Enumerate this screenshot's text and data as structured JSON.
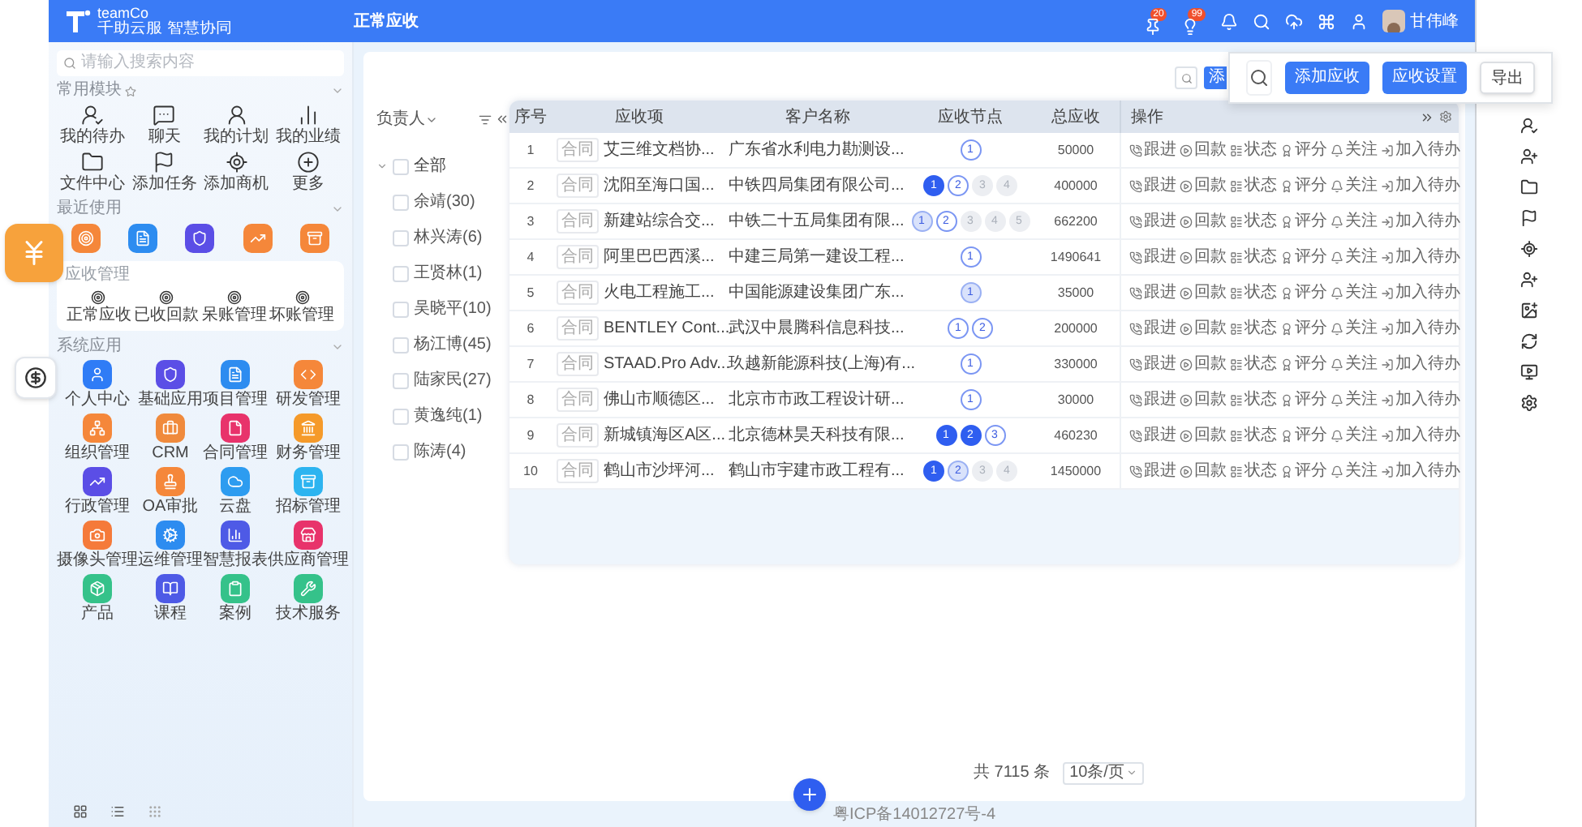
{
  "app": {
    "logo": "teamCo",
    "tagline": "千助云服 智慧协同",
    "page_title": "正常应收",
    "user": "甘伟峰",
    "badges": [
      "20",
      "99"
    ]
  },
  "sidebar": {
    "search_placeholder": "请输入搜索内容",
    "favorites": {
      "title": "常用模块",
      "items": [
        "我的待办",
        "聊天",
        "我的计划",
        "我的业绩",
        "文件中心",
        "添加任务",
        "添加商机",
        "更多"
      ]
    },
    "recent": {
      "title": "最近使用",
      "items": [
        {
          "color": "#f5873a"
        },
        {
          "color": "#2d8cf0"
        },
        {
          "color": "#5b4ee6"
        },
        {
          "color": "#f5873a"
        },
        {
          "color": "#f5873a"
        }
      ]
    },
    "receivables": {
      "title": "应收管理",
      "items": [
        "正常应收",
        "已收回款",
        "呆账管理",
        "坏账管理"
      ]
    },
    "apps": {
      "title": "系统应用",
      "items": [
        {
          "label": "个人中心",
          "color": "#2f7cf6"
        },
        {
          "label": "基础应用",
          "color": "#5b4ee6"
        },
        {
          "label": "项目管理",
          "color": "#2d8cf0"
        },
        {
          "label": "研发管理",
          "color": "#f5873a"
        },
        {
          "label": "组织管理",
          "color": "#f5873a"
        },
        {
          "label": "CRM",
          "color": "#f08a3c"
        },
        {
          "label": "合同管理",
          "color": "#e8336b"
        },
        {
          "label": "财务管理",
          "color": "#f59a2a"
        },
        {
          "label": "行政管理",
          "color": "#5b4ee6"
        },
        {
          "label": "OA审批",
          "color": "#f5873a"
        },
        {
          "label": "云盘",
          "color": "#2d9cf0"
        },
        {
          "label": "招标管理",
          "color": "#2db4f0"
        },
        {
          "label": "摄像头管理",
          "color": "#f57a3a"
        },
        {
          "label": "运维管理",
          "color": "#2d8cf0"
        },
        {
          "label": "智慧报表",
          "color": "#4e5ae6"
        },
        {
          "label": "供应商管理",
          "color": "#e8336b"
        },
        {
          "label": "产品",
          "color": "#35c28a"
        },
        {
          "label": "课程",
          "color": "#4e5ae6"
        },
        {
          "label": "案例",
          "color": "#35c28a"
        },
        {
          "label": "技术服务",
          "color": "#35c28a"
        }
      ]
    }
  },
  "toolbar": {
    "covered_button": "添",
    "popup_buttons": [
      {
        "label": "添加应收",
        "kind": "primary"
      },
      {
        "label": "应收设置",
        "kind": "primary"
      },
      {
        "label": "导出",
        "kind": "plain"
      }
    ]
  },
  "tree": {
    "header": "负责人",
    "root": {
      "label": "全部",
      "expanded": true,
      "checked": false,
      "children": [
        {
          "label": "余靖(30)",
          "checked": false
        },
        {
          "label": "林兴涛(6)",
          "checked": false
        },
        {
          "label": "王贤林(1)",
          "checked": false
        },
        {
          "label": "吴晓平(10)",
          "checked": false
        },
        {
          "label": "杨江博(45)",
          "checked": false
        },
        {
          "label": "陆家民(27)",
          "checked": false
        },
        {
          "label": "黄逸纯(1)",
          "checked": false
        },
        {
          "label": "陈涛(4)",
          "checked": false
        }
      ]
    }
  },
  "table": {
    "columns": [
      "序号",
      "应收项",
      "客户名称",
      "应收节点",
      "总应收"
    ],
    "action_column": "操作",
    "rows": [
      {
        "no": "1",
        "tag": "合同",
        "item": "艾三维文档协...",
        "customer": "广东省水利电力勘测设...",
        "nodes": [
          {
            "label": "1",
            "kind": "current"
          }
        ],
        "total": "50000",
        "actions": [
          "跟进",
          "回款",
          "状态",
          "评分",
          "关注",
          "加入待办"
        ]
      },
      {
        "no": "2",
        "tag": "合同",
        "item": "沈阳至海口国...",
        "customer": "中铁四局集团有限公司...",
        "nodes": [
          {
            "label": "1",
            "kind": "done"
          },
          {
            "label": "2",
            "kind": "current"
          },
          {
            "label": "3",
            "kind": "pending"
          },
          {
            "label": "4",
            "kind": "pending"
          }
        ],
        "total": "400000",
        "actions": [
          "跟进",
          "回款",
          "状态",
          "评分",
          "关注",
          "加入待办"
        ]
      },
      {
        "no": "3",
        "tag": "合同",
        "item": "新建站综合交...",
        "customer": "中铁二十五局集团有限...",
        "nodes": [
          {
            "label": "1",
            "kind": "partial"
          },
          {
            "label": "2",
            "kind": "current"
          },
          {
            "label": "3",
            "kind": "pending"
          },
          {
            "label": "4",
            "kind": "pending"
          },
          {
            "label": "5",
            "kind": "pending"
          }
        ],
        "total": "662200",
        "actions": [
          "跟进",
          "回款",
          "状态",
          "评分",
          "关注",
          "加入待办"
        ]
      },
      {
        "no": "4",
        "tag": "合同",
        "item": "阿里巴巴西溪...",
        "customer": "中建三局第一建设工程...",
        "nodes": [
          {
            "label": "1",
            "kind": "current"
          }
        ],
        "total": "1490641",
        "actions": [
          "跟进",
          "回款",
          "状态",
          "评分",
          "关注",
          "加入待办"
        ]
      },
      {
        "no": "5",
        "tag": "合同",
        "item": "火电工程施工...",
        "customer": "中国能源建设集团广东...",
        "nodes": [
          {
            "label": "1",
            "kind": "partial"
          }
        ],
        "total": "35000",
        "actions": [
          "跟进",
          "回款",
          "状态",
          "评分",
          "关注",
          "加入待办"
        ]
      },
      {
        "no": "6",
        "tag": "合同",
        "item": "BENTLEY Cont...",
        "customer": "武汉中晨腾科信息科技...",
        "nodes": [
          {
            "label": "1",
            "kind": "current"
          },
          {
            "label": "2",
            "kind": "current"
          }
        ],
        "total": "200000",
        "actions": [
          "跟进",
          "回款",
          "状态",
          "评分",
          "关注",
          "加入待办"
        ]
      },
      {
        "no": "7",
        "tag": "合同",
        "item": "STAAD.Pro Adv...",
        "customer": "玖越新能源科技(上海)有...",
        "nodes": [
          {
            "label": "1",
            "kind": "current"
          }
        ],
        "total": "330000",
        "actions": [
          "跟进",
          "回款",
          "状态",
          "评分",
          "关注",
          "加入待办"
        ]
      },
      {
        "no": "8",
        "tag": "合同",
        "item": "佛山市顺德区...",
        "customer": "北京市市政工程设计研...",
        "nodes": [
          {
            "label": "1",
            "kind": "current"
          }
        ],
        "total": "30000",
        "actions": [
          "跟进",
          "回款",
          "状态",
          "评分",
          "关注",
          "加入待办"
        ]
      },
      {
        "no": "9",
        "tag": "合同",
        "item": "新城镇海区A区...",
        "customer": "北京德林昊天科技有限...",
        "nodes": [
          {
            "label": "1",
            "kind": "done"
          },
          {
            "label": "2",
            "kind": "done"
          },
          {
            "label": "3",
            "kind": "current"
          }
        ],
        "total": "460230",
        "actions": [
          "跟进",
          "回款",
          "状态",
          "评分",
          "关注",
          "加入待办"
        ]
      },
      {
        "no": "10",
        "tag": "合同",
        "item": "鹤山市沙坪河...",
        "customer": "鹤山市宇建市政工程有...",
        "nodes": [
          {
            "label": "1",
            "kind": "done"
          },
          {
            "label": "2",
            "kind": "partial"
          },
          {
            "label": "3",
            "kind": "pending"
          },
          {
            "label": "4",
            "kind": "pending"
          }
        ],
        "total": "1450000",
        "actions": [
          "跟进",
          "回款",
          "状态",
          "评分",
          "关注",
          "加入待办"
        ]
      }
    ]
  },
  "pagination": {
    "total": "共 7115 条",
    "page_size": "10条/页"
  },
  "footer": "粤ICP备14012727号-4"
}
